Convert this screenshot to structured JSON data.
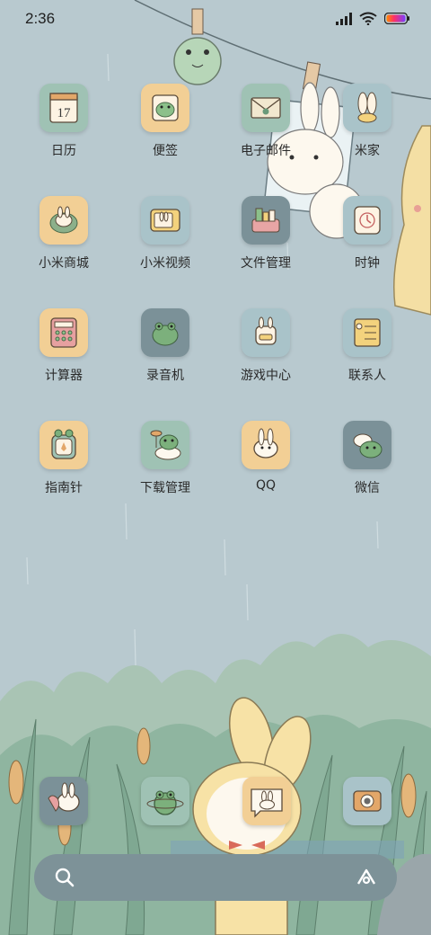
{
  "status_bar": {
    "time": "2:36"
  },
  "apps": [
    {
      "label": "日历",
      "icon": "calendar-icon",
      "bg": "#9fc2b4",
      "calendar_day": "17"
    },
    {
      "label": "便签",
      "icon": "notes-frog-icon",
      "bg": "#f2cf95"
    },
    {
      "label": "电子邮件",
      "icon": "mail-icon",
      "bg": "#9fc2b4"
    },
    {
      "label": "米家",
      "icon": "mijia-bunny-icon",
      "bg": "#a9c3c9"
    },
    {
      "label": "小米商城",
      "icon": "shop-bunny-icon",
      "bg": "#f2cf95"
    },
    {
      "label": "小米视频",
      "icon": "video-tv-icon",
      "bg": "#a9c3c9"
    },
    {
      "label": "文件管理",
      "icon": "file-manager-icon",
      "bg": "#7b9198"
    },
    {
      "label": "时钟",
      "icon": "clock-icon",
      "bg": "#a9c3c9"
    },
    {
      "label": "计算器",
      "icon": "calculator-icon",
      "bg": "#f2cf95"
    },
    {
      "label": "录音机",
      "icon": "recorder-frog-icon",
      "bg": "#7b9198"
    },
    {
      "label": "游戏中心",
      "icon": "game-center-icon",
      "bg": "#a9c3c9"
    },
    {
      "label": "联系人",
      "icon": "contacts-icon",
      "bg": "#a9c3c9"
    },
    {
      "label": "指南针",
      "icon": "compass-frog-icon",
      "bg": "#f2cf95"
    },
    {
      "label": "下载管理",
      "icon": "download-frog-icon",
      "bg": "#9fc2b4"
    },
    {
      "label": "QQ",
      "icon": "qq-bunny-icon",
      "bg": "#f2cf95"
    },
    {
      "label": "微信",
      "icon": "wechat-frog-icon",
      "bg": "#7b9198"
    }
  ],
  "dock": [
    {
      "icon": "phone-bunny-icon",
      "bg": "#7b9198"
    },
    {
      "icon": "browser-frog-icon",
      "bg": "#9fc2b4"
    },
    {
      "icon": "messages-bunny-icon",
      "bg": "#f2cf95"
    },
    {
      "icon": "camera-icon",
      "bg": "#a9c3c9"
    }
  ],
  "search": {
    "icon": "search-icon",
    "assistant_icon": "assistant-icon"
  }
}
